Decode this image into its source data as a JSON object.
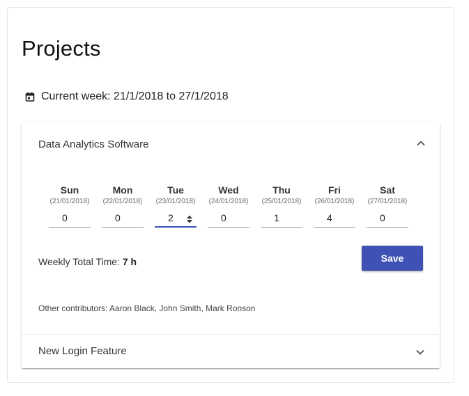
{
  "page": {
    "title": "Projects"
  },
  "week": {
    "icon": "calendar-icon",
    "label": "Current week: 21/1/2018 to 27/1/2018"
  },
  "projects": [
    {
      "name": "Data Analytics Software",
      "expanded": true,
      "toggle_icon": "chevron-up-icon",
      "days": [
        {
          "name": "Sun",
          "date": "(21/01/2018)",
          "value": "0"
        },
        {
          "name": "Mon",
          "date": "(22/01/2018)",
          "value": "0"
        },
        {
          "name": "Tue",
          "date": "(23/01/2018)",
          "value": "2"
        },
        {
          "name": "Wed",
          "date": "(24/01/2018)",
          "value": "0"
        },
        {
          "name": "Thu",
          "date": "(25/01/2018)",
          "value": "1"
        },
        {
          "name": "Fri",
          "date": "(26/01/2018)",
          "value": "4"
        },
        {
          "name": "Sat",
          "date": "(27/01/2018)",
          "value": "0"
        }
      ],
      "total_label": "Weekly Total Time:",
      "total_value": "7 h",
      "save_label": "Save",
      "contributors": "Other contributors: Aaron Black, John Smith, Mark Ronson"
    },
    {
      "name": "New Login Feature",
      "expanded": false,
      "toggle_icon": "chevron-down-icon"
    }
  ],
  "colors": {
    "accent": "#3f51b5"
  }
}
